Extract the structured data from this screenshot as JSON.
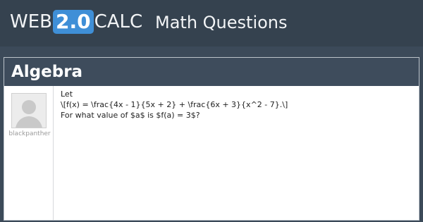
{
  "header": {
    "logo": {
      "prefix": "WEB",
      "badge": "2.0",
      "suffix": "CALC"
    },
    "site_title": "Math Questions"
  },
  "category": "Algebra",
  "post": {
    "username": "blackpanther",
    "lines": [
      "Let",
      "\\[f(x) = \\frac{4x - 1}{5x + 2} + \\frac{6x + 3}{x^2 - 7}.\\]",
      "For what value of $a$ is $f(a) = 3$?"
    ]
  },
  "colors": {
    "background": "#3c4a59",
    "badge": "#3f8fd7",
    "card": "#ffffff"
  },
  "icons": {
    "avatar": "default-user-avatar"
  }
}
